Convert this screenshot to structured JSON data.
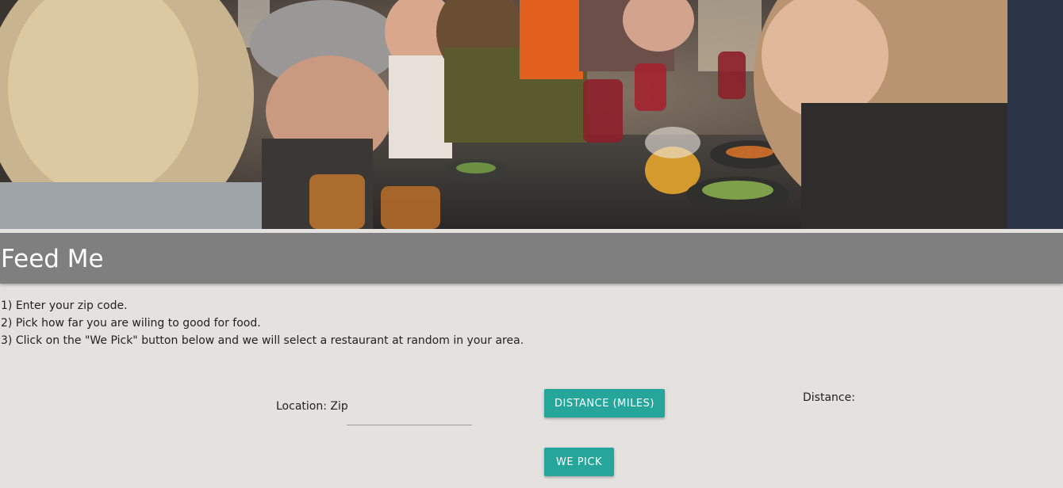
{
  "hero": {
    "image_icon": "people-dining-photo"
  },
  "header": {
    "title": "Feed Me"
  },
  "instructions": [
    "1) Enter your zip code.",
    "2) Pick how far you are wiling to good for food.",
    "3) Click on the \"We Pick\" button below and we will select a restaurant at random in your area."
  ],
  "form": {
    "zip_label": "Location: Zip",
    "zip_value": "",
    "zip_placeholder": "",
    "distance_button_label": "Distance (Miles)",
    "distance_label": "Distance:",
    "pick_button_label": "We Pick"
  },
  "colors": {
    "page_background": "#e3e2df",
    "header_background": "#7f7f7f",
    "header_text": "#ffffff",
    "button_background": "#26a69a",
    "button_text": "#ffffff"
  }
}
